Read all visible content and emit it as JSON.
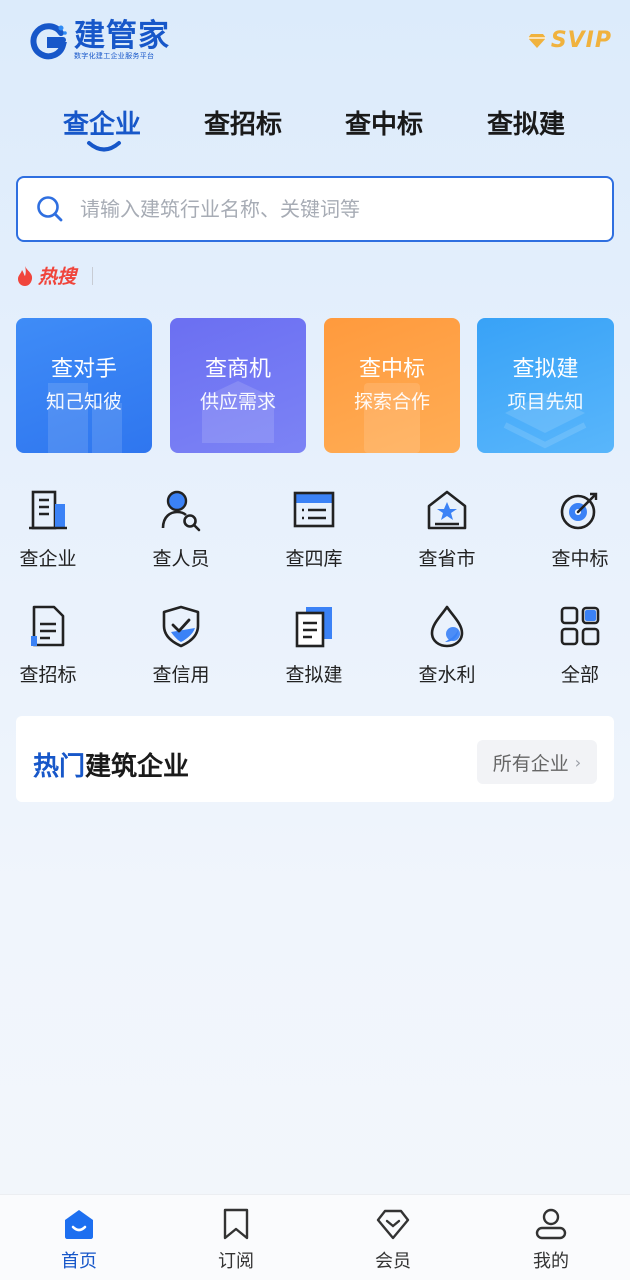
{
  "header": {
    "app_name": "建管家",
    "app_tagline": "数字化建工企业服务平台",
    "vip_label": "SVIP"
  },
  "tabs": [
    {
      "label": "查企业",
      "active": true
    },
    {
      "label": "查招标",
      "active": false
    },
    {
      "label": "查中标",
      "active": false
    },
    {
      "label": "查拟建",
      "active": false
    }
  ],
  "search": {
    "placeholder": "请输入建筑行业名称、关键词等",
    "value": ""
  },
  "hot_search": {
    "label": "热搜"
  },
  "feature_cards": [
    {
      "title": "查对手",
      "subtitle": "知己知彼",
      "color": "#3582f4"
    },
    {
      "title": "查商机",
      "subtitle": "供应需求",
      "color": "#7378f4"
    },
    {
      "title": "查中标",
      "subtitle": "探索合作",
      "color": "#ffa248"
    },
    {
      "title": "查拟建",
      "subtitle": "项目先知",
      "color": "#48acf9"
    }
  ],
  "grid": [
    {
      "label": "查企业",
      "icon": "building-icon"
    },
    {
      "label": "查人员",
      "icon": "person-search-icon"
    },
    {
      "label": "查四库",
      "icon": "database-list-icon"
    },
    {
      "label": "查省市",
      "icon": "house-star-icon"
    },
    {
      "label": "查中标",
      "icon": "target-icon"
    },
    {
      "label": "查招标",
      "icon": "document-icon"
    },
    {
      "label": "查信用",
      "icon": "shield-check-icon"
    },
    {
      "label": "查拟建",
      "icon": "files-icon"
    },
    {
      "label": "查水利",
      "icon": "water-drop-icon"
    },
    {
      "label": "全部",
      "icon": "grid-apps-icon"
    }
  ],
  "hot_companies": {
    "title_highlight": "热门",
    "title_rest": "建筑企业",
    "all_button": "所有企业"
  },
  "bottom_nav": [
    {
      "label": "首页",
      "icon": "home-icon",
      "active": true
    },
    {
      "label": "订阅",
      "icon": "bookmark-icon",
      "active": false
    },
    {
      "label": "会员",
      "icon": "diamond-icon",
      "active": false
    },
    {
      "label": "我的",
      "icon": "user-icon",
      "active": false
    }
  ],
  "colors": {
    "brand": "#1757c9",
    "accent_blue": "#2f6fe0",
    "hot_red": "#f0453c",
    "vip_gold": "#f0b23d"
  }
}
